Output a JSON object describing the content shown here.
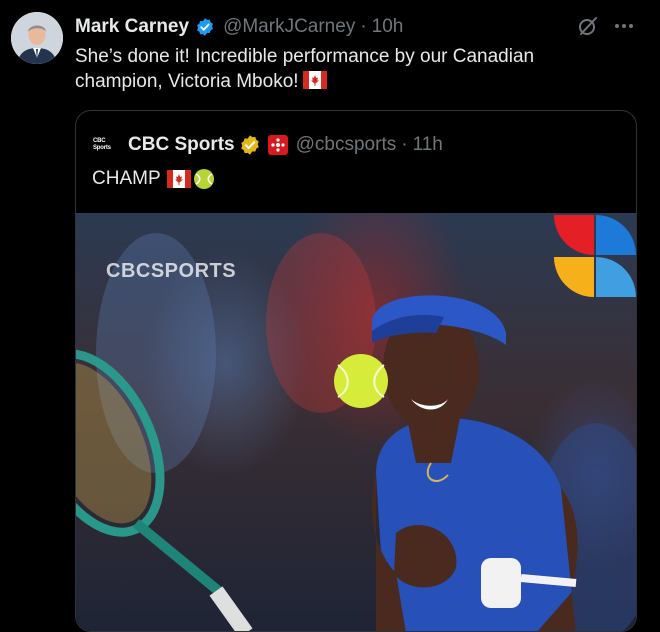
{
  "tweet": {
    "author_name": "Mark Carney",
    "handle": "@MarkJCarney",
    "separator": "·",
    "time": "10h",
    "text": "She’s done it! Incredible performance by our Canadian champion, Victoria Mboko!",
    "flag_icon": "canada-flag-icon"
  },
  "quote": {
    "logo_text": "CBC",
    "logo_subtext": "Sports",
    "author_name": "CBC Sports",
    "handle": "@cbcsports",
    "separator": "·",
    "time": "11h",
    "text": "CHAMP",
    "media": {
      "watermark": "CBCSPORTS",
      "description_icons": [
        "tennis-ball",
        "racket",
        "cbc-logo"
      ]
    }
  },
  "colors": {
    "background": "#000000",
    "text": "#e7e9ea",
    "muted": "#71767b",
    "verified_blue": "#1d9bf0",
    "gold": "#e2b719",
    "border": "#2f3336"
  }
}
